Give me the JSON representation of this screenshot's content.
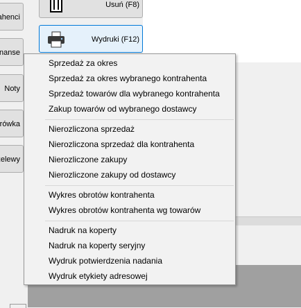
{
  "sidebar": {
    "items": [
      {
        "label": "ahenci"
      },
      {
        "label": "inanse"
      },
      {
        "label": "Noty"
      },
      {
        "label": "rówka"
      },
      {
        "label": "zelewy"
      }
    ]
  },
  "toolbar": {
    "delete_label": "Usuń (F8)",
    "print_label": "Wydruki (F12)"
  },
  "context_menu": {
    "group1": [
      "Sprzedaż za okres",
      "Sprzedaż za okres  wybranego kontrahenta",
      "Sprzedaż towarów dla wybranego kontrahenta",
      "Zakup towarów od wybranego dostawcy"
    ],
    "group2": [
      "Nierozliczona sprzedaż",
      "Nierozliczona sprzedaż dla kontrahenta",
      "Nierozliczone zakupy",
      "Nierozliczone zakupy od dostawcy"
    ],
    "group3": [
      "Wykres obrotów kontrahenta",
      "Wykres obrotów kontrahenta wg towarów"
    ],
    "group4": [
      "Nadruk na koperty",
      "Nadruk na koperty seryjny",
      "Wydruk potwierdzenia nadania",
      "Wydruk etykiety adresowej"
    ]
  },
  "colors": {
    "accent": "#0078d7",
    "menu_bg": "#f2f2f2",
    "panel_gray": "#a0a0a0"
  }
}
